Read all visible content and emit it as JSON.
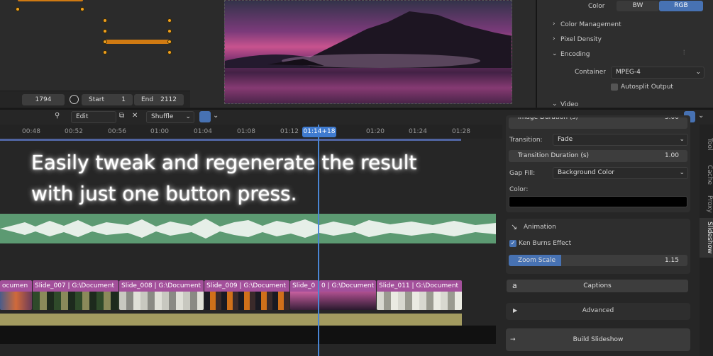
{
  "graph": {
    "current_frame": "1794",
    "start_label": "Start",
    "start_value": "1",
    "end_label": "End",
    "end_value": "2112"
  },
  "props": {
    "color_label": "Color",
    "color_options": [
      "BW",
      "RGB"
    ],
    "color_selected": "RGB",
    "color_management": "Color Management",
    "pixel_density": "Pixel Density",
    "encoding": "Encoding",
    "container_label": "Container",
    "container_value": "MPEG-4",
    "autosplit_label": "Autosplit Output",
    "video": "Video"
  },
  "header": {
    "mode": "Edit",
    "shuffle": "Shuffle"
  },
  "ruler": {
    "ticks": [
      "00:48",
      "00:52",
      "00:56",
      "01:00",
      "01:04",
      "01:08",
      "01:12",
      "01:20",
      "01:24",
      "01:28"
    ],
    "playhead": "01:14+18"
  },
  "overlay": {
    "line1": "Easily tweak and regenerate the result",
    "line2": "with just one button press."
  },
  "strips": [
    {
      "label": "ocumen"
    },
    {
      "label": "Slide_007 | G:\\Document"
    },
    {
      "label": "Slide_008 | G:\\Document"
    },
    {
      "label": "Slide_009 | G:\\Document"
    },
    {
      "label": "Slide_0"
    },
    {
      "label": "0 | G:\\Document"
    },
    {
      "label": "Slide_011 | G:\\Document"
    }
  ],
  "sidebar": {
    "image_duration": "Image Duration (s)",
    "image_duration_value": "5.00",
    "transition_label": "Transition:",
    "transition_value": "Fade",
    "transition_duration_label": "Transition Duration (s)",
    "transition_duration_value": "1.00",
    "gap_fill_label": "Gap Fill:",
    "gap_fill_value": "Background Color",
    "color_label": "Color:",
    "animation_label": "Animation",
    "ken_burns_label": "Ken Burns Effect",
    "zoom_scale_label": "Zoom Scale",
    "zoom_scale_value": "1.15",
    "captions_label": "Captions",
    "advanced_label": "Advanced",
    "build_label": "Build Slideshow"
  },
  "tabs": [
    "Tool",
    "Cache",
    "Proxy",
    "Slideshow"
  ],
  "colors": {
    "strip_header": "#a3509b",
    "audio": "#5c9a72",
    "adjustment": "#a39b60",
    "accent": "#4772b3",
    "keyframe": "#f0a020"
  }
}
